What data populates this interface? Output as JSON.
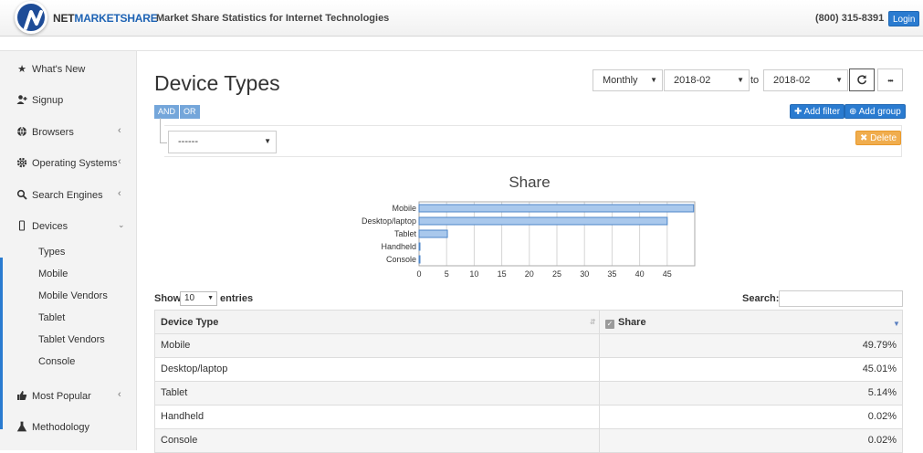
{
  "header": {
    "brand_part1": "NET",
    "brand_part2": "MARKETSHARE",
    "tagline": "Market Share Statistics for Internet Technologies",
    "phone": "(800) 315-8391",
    "login_label": "Login"
  },
  "sidebar": {
    "items": [
      {
        "label": "What's New",
        "icon": "star-icon"
      },
      {
        "label": "Signup",
        "icon": "user-plus-icon"
      },
      {
        "label": "Browsers",
        "icon": "globe-icon"
      },
      {
        "label": "Operating Systems",
        "icon": "gear-icon"
      },
      {
        "label": "Search Engines",
        "icon": "search-icon"
      },
      {
        "label": "Devices",
        "icon": "mobile-icon"
      },
      {
        "label": "Most Popular",
        "icon": "thumbs-up-icon"
      },
      {
        "label": "Methodology",
        "icon": "flask-icon"
      }
    ],
    "device_subitems": [
      "Types",
      "Mobile",
      "Mobile Vendors",
      "Tablet",
      "Tablet Vendors",
      "Console"
    ]
  },
  "page": {
    "title": "Device Types",
    "period": "Monthly",
    "date_from": "2018-02",
    "to_label": "to",
    "date_to": "2018-02",
    "more_label": "•••",
    "and_label": "AND",
    "or_label": "OR",
    "add_filter_label": "Add filter",
    "add_group_label": "Add group",
    "filter_value": "------",
    "delete_label": "Delete"
  },
  "chart_data": {
    "type": "bar",
    "orientation": "horizontal",
    "title": "Share",
    "categories": [
      "Mobile",
      "Desktop/laptop",
      "Tablet",
      "Handheld",
      "Console"
    ],
    "values": [
      49.79,
      45.01,
      5.14,
      0.02,
      0.02
    ],
    "xticks": [
      "0",
      "5",
      "10",
      "15",
      "20",
      "25",
      "30",
      "35",
      "40",
      "45"
    ],
    "xlim": [
      0,
      50
    ],
    "grid": true,
    "bar_color": "#a9c8ec",
    "bar_border": "#4d86c9"
  },
  "table": {
    "show_label": "Show",
    "entries_value": "10",
    "entries_label": "entries",
    "search_label": "Search:",
    "columns": [
      "Device Type",
      "Share"
    ],
    "rows": [
      [
        "Mobile",
        "49.79%"
      ],
      [
        "Desktop/laptop",
        "45.01%"
      ],
      [
        "Tablet",
        "5.14%"
      ],
      [
        "Handheld",
        "0.02%"
      ],
      [
        "Console",
        "0.02%"
      ]
    ]
  }
}
